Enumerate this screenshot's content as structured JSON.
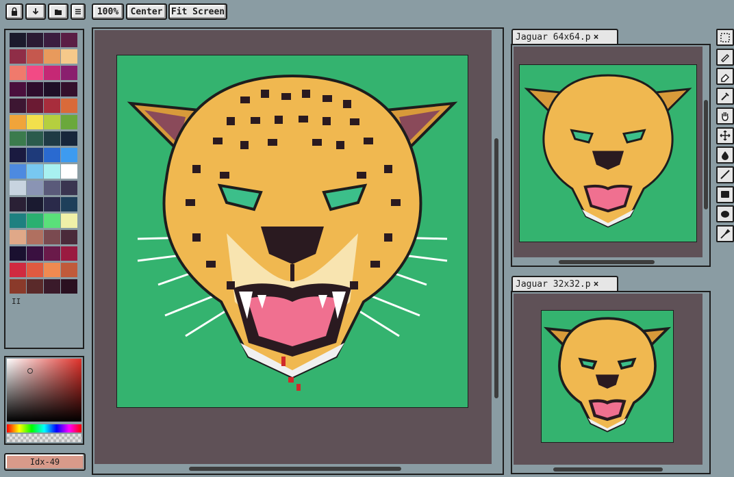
{
  "toolbar": {
    "icons": [
      "lock-icon",
      "download-icon",
      "folder-icon",
      "menu-icon"
    ],
    "zoom_label": "100%",
    "center_label": "Center",
    "fit_label": "Fit Screen"
  },
  "palette": {
    "colors": [
      "#1b1a2c",
      "#2a1a33",
      "#3b1d3f",
      "#5a1e45",
      "#8f2d47",
      "#c5584e",
      "#e89a5c",
      "#f5c98a",
      "#f07a6c",
      "#f24a85",
      "#c52875",
      "#8a1f6e",
      "#4a0f3d",
      "#2d0d2c",
      "#1f0f27",
      "#34102c",
      "#3d1632",
      "#6b1a33",
      "#a82d3c",
      "#d96a3a",
      "#f0a43a",
      "#f2e04c",
      "#b5cf3f",
      "#6aa83c",
      "#3b7b4d",
      "#2b5b4d",
      "#1f3b45",
      "#17263b",
      "#1a1a40",
      "#1e3a7a",
      "#2a6ad0",
      "#3d9bf0",
      "#4d8ae0",
      "#78c8f0",
      "#a8f0f0",
      "#ffffff",
      "#c8d4e0",
      "#8a94b4",
      "#5a5a7a",
      "#3a3550",
      "#2a2035",
      "#1a1a30",
      "#2a2a4a",
      "#1e3f5a",
      "#1e8080",
      "#2ab070",
      "#5ae07a",
      "#f0f0a8",
      "#e0a888",
      "#b07060",
      "#7a4a50",
      "#4a2a3a",
      "#1a1030",
      "#3a1040",
      "#6a1a4a",
      "#9a1a40",
      "#d02a40",
      "#e05a40",
      "#f08a50",
      "#c05a3a",
      "#8a3a2a",
      "#5a2a2a",
      "#3a1a2a",
      "#2a1020"
    ],
    "marker": "II"
  },
  "color_picker": {
    "hue_bar_colors": [
      "#ff0000",
      "#ffff00",
      "#00ff00",
      "#00ffff",
      "#0000ff",
      "#ff00ff",
      "#ff0000"
    ],
    "index_label": "Idx-49"
  },
  "main_canvas": {
    "frame_color": "#5f5157",
    "background_color": "#34b36f"
  },
  "previews": [
    {
      "tab_label": "Jaguar 64x64.p",
      "close": "×"
    },
    {
      "tab_label": "Jaguar 32x32.p",
      "close": "×"
    }
  ],
  "tools": [
    "selection-icon",
    "pencil-icon",
    "eraser-icon",
    "eyedropper-icon",
    "hand-icon",
    "move-icon",
    "fill-icon",
    "line-icon",
    "rectangle-icon",
    "ellipse-icon",
    "brush-icon"
  ]
}
